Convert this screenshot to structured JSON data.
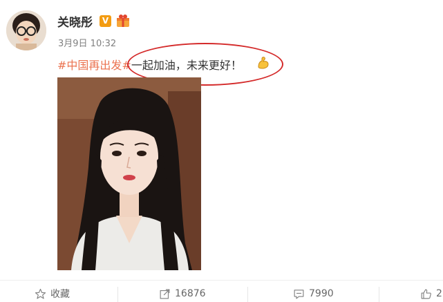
{
  "user": {
    "name": "关晓彤",
    "verified_badge": "V",
    "avatar_icon": "avatar-girl-glasses",
    "gift_icon": "gift-icon"
  },
  "post": {
    "timestamp": "3月9日 10:32",
    "hashtag": "#中国再出发#",
    "text": "一起加油，未来更好！",
    "emoji": "muscle-icon",
    "highlight_color": "#d42a2a"
  },
  "actions": {
    "favorite_label": "收藏",
    "repost_count": "16876",
    "comment_count": "7990",
    "like_count": "2"
  },
  "colors": {
    "hashtag": "#eb7350",
    "verified": "#f39c12",
    "name": "#333333",
    "meta": "#808080"
  }
}
